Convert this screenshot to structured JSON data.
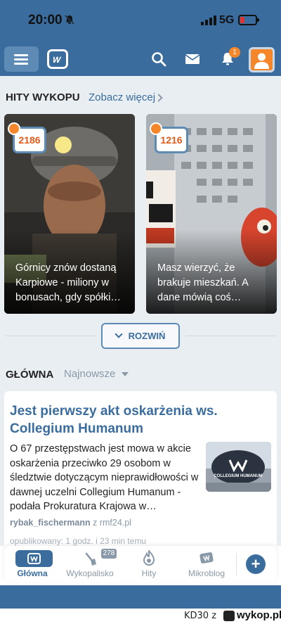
{
  "status_bar": {
    "time": "20:00",
    "network": "5G"
  },
  "top_bar": {
    "notification_count": "1"
  },
  "hits_section": {
    "heading": "HITY WYKOPU",
    "see_more": "Zobacz więcej",
    "cards": [
      {
        "score": "2186",
        "title": "Górnicy znów dostaną Karpiowe - miliony w bonusach, gdy spółki…"
      },
      {
        "score": "1216",
        "title": "Masz wierzyć, że brakuje mieszkań. A dane mówią coś…"
      }
    ],
    "expand_label": "ROZWIŃ"
  },
  "main_section": {
    "heading": "GŁÓWNA",
    "sort_label": "Najnowsze"
  },
  "article": {
    "title": "Jest pierwszy akt oskarżenia ws. Collegium Humanum",
    "description": "O 67 przestępstwach jest mowa w akcie oskarżenia przeciwko 29 osobom w śledztwie dotyczącym nieprawidłowości w dawnej uczelni Collegium Humanum - podała Prokuratura Krajowa w…",
    "author": "rybak_fischermann",
    "source_prefix": " z ",
    "source": "rmf24.pl",
    "published": "opublikowany: 1 godz. i 23 min temu",
    "thumb_caption": "COLLEGIUM HUMANUM"
  },
  "bottom_nav": {
    "items": [
      {
        "label": "Główna"
      },
      {
        "label": "Wykopalisko",
        "badge": "278"
      },
      {
        "label": "Hity"
      },
      {
        "label": "Mikroblog"
      }
    ]
  },
  "watermark": {
    "user": "KD30 z",
    "site": "wykop.pl"
  },
  "colors": {
    "brand_blue": "#3a6d9e",
    "accent_orange": "#f5872a",
    "background": "#e9eef3"
  }
}
